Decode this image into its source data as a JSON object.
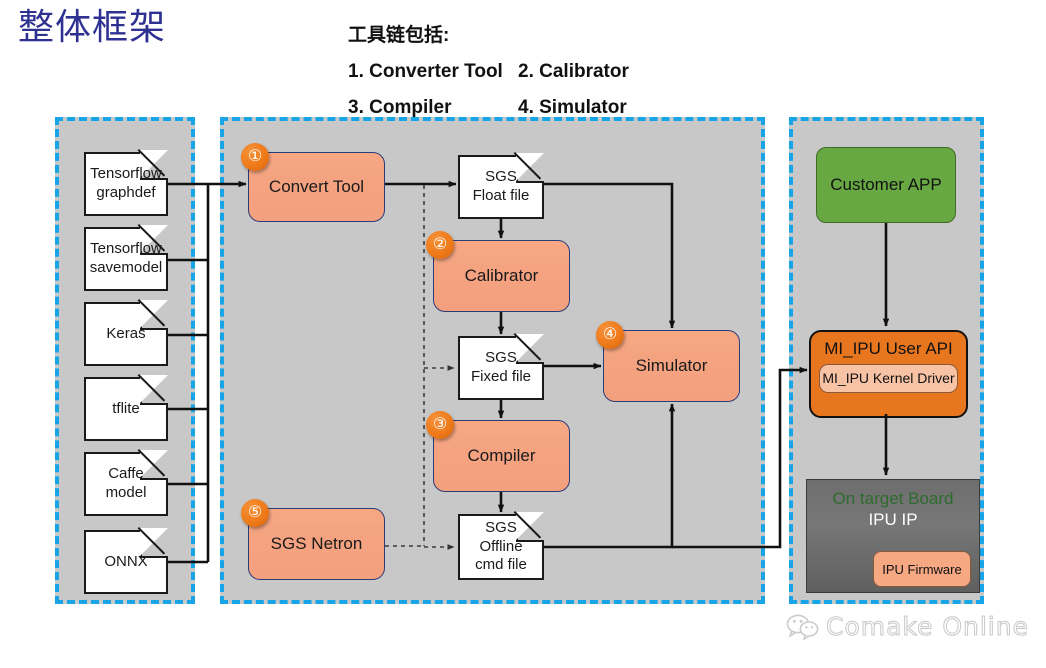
{
  "slide": {
    "title": "整体框架",
    "toolchain_heading": "工具链包括:",
    "toolchain_items": [
      "1. Converter Tool",
      "2. Calibrator",
      "3. Compiler",
      "4. Simulator"
    ]
  },
  "colors": {
    "panel_fill": "#c8c8c8",
    "panel_border": "#18a5e8",
    "tool_fill": "#f4a280",
    "badge": "#ef7a19",
    "app_green": "#68a843",
    "api_orange": "#e8761e",
    "board_gray": "#6e6e6e",
    "title_navy": "#2f3192"
  },
  "left_panel": {
    "name": "model-inputs",
    "files": [
      {
        "line1": "Tensorflow",
        "line2": "graphdef"
      },
      {
        "line1": "Tensorflow",
        "line2": "savemodel"
      },
      {
        "line1": "Keras",
        "line2": ""
      },
      {
        "line1": "tflite",
        "line2": ""
      },
      {
        "line1": "Caffe",
        "line2": "model"
      },
      {
        "line1": "ONNX",
        "line2": ""
      }
    ]
  },
  "middle_panel": {
    "name": "sgs-toolchain",
    "tools": [
      {
        "label": "Convert Tool",
        "badge": "①"
      },
      {
        "label": "Calibrator",
        "badge": "②"
      },
      {
        "label": "Compiler",
        "badge": "③"
      },
      {
        "label": "Simulator",
        "badge": "④"
      },
      {
        "label": "SGS Netron",
        "badge": "⑤"
      }
    ],
    "files": [
      {
        "line1": "SGS",
        "line2": "Float file",
        "line3": ""
      },
      {
        "line1": "SGS",
        "line2": "Fixed file",
        "line3": ""
      },
      {
        "line1": "SGS",
        "line2": "Offline",
        "line3": "cmd file"
      }
    ]
  },
  "right_panel": {
    "name": "runtime-stack",
    "customer_app": "Customer APP",
    "user_api": "MI_IPU User API",
    "kernel_driver": "MI_IPU Kernel Driver",
    "board_title": "On target Board",
    "board_subtitle": "IPU IP",
    "firmware": "IPU Firmware"
  },
  "watermark": {
    "text": "Comake Online",
    "icon": "wechat-icon"
  }
}
